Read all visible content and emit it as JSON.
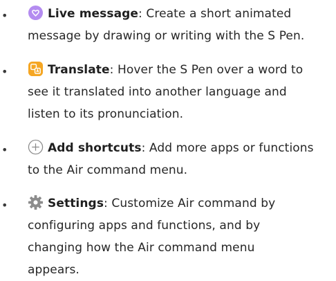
{
  "items": [
    {
      "icon": "live-message-icon",
      "title": "Live message",
      "line1": ": Create a short animated",
      "line2": "message by drawing or writing with the S Pen.",
      "line3": "",
      "line4": ""
    },
    {
      "icon": "translate-icon",
      "title": "Translate",
      "line1": ": Hover the S Pen over a word to",
      "line2": "see it translated into another language and",
      "line3": "listen to its pronunciation.",
      "line4": ""
    },
    {
      "icon": "add-circle-icon",
      "title": "Add shortcuts",
      "line1": ": Add more apps or functions",
      "line2": "to the Air command menu.",
      "line3": "",
      "line4": ""
    },
    {
      "icon": "gear-icon",
      "title": "Settings",
      "line1": ": Customize Air command by",
      "line2": "configuring apps and functions, and by",
      "line3": "changing how the Air command menu",
      "line4": "appears."
    }
  ],
  "bullet": "•",
  "colors": {
    "live_message": "#b48cf0",
    "translate": "#f5a623",
    "add_shortcuts": "#8a8a8a",
    "settings": "#8c8c8c"
  }
}
